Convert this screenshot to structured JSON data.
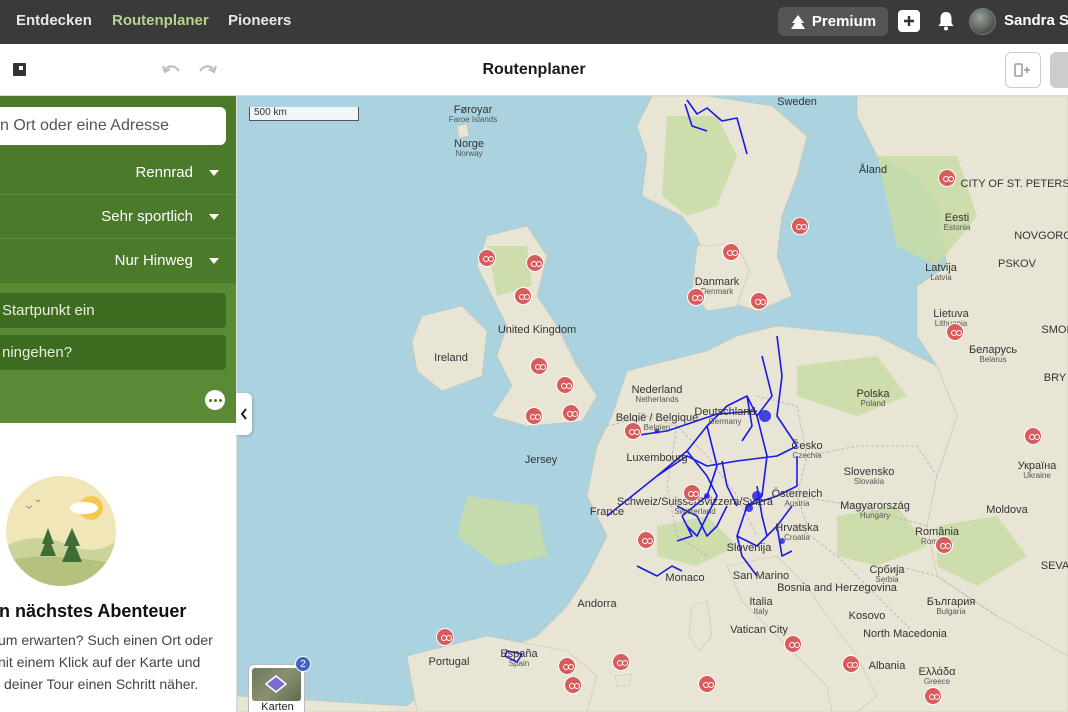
{
  "topnav": {
    "links": [
      "Entdecken",
      "Routenplaner",
      "Pioneers"
    ],
    "premium_label": "Premium",
    "username": "Sandra Sc"
  },
  "subbar": {
    "title": "Routenplaner"
  },
  "sidebar": {
    "search_placeholder": "n Ort oder eine Adresse",
    "sport": "Rennrad",
    "fitness": "Sehr sportlich",
    "route_type": "Nur Hinweg",
    "start_field": "Startpunkt ein",
    "dest_field": "ningehen?",
    "adventure_heading": "in nächstes Abenteuer",
    "adventure_lines": [
      "um erwarten? Such einen Ort oder",
      "nit einem Klick auf der Karte und",
      "deiner Tour einen Schritt näher."
    ]
  },
  "map": {
    "scale": "500 km",
    "layer_label": "Karten",
    "layer_badge": "2",
    "route_color": "#1a1ae6",
    "marker_color": "#d95b5b",
    "labels": [
      {
        "name": "Føroyar",
        "sub": "Faroe Islands"
      },
      {
        "name": "Norge",
        "sub": "Norway"
      },
      {
        "name": "Åland",
        "sub": ""
      },
      {
        "name": "CITY OF ST. PETERSBURG",
        "sub": ""
      },
      {
        "name": "Eesti",
        "sub": "Estonia"
      },
      {
        "name": "NOVGOROD",
        "sub": ""
      },
      {
        "name": "PSKOV",
        "sub": ""
      },
      {
        "name": "Latvija",
        "sub": "Latvia"
      },
      {
        "name": "Danmark",
        "sub": "Denmark"
      },
      {
        "name": "Lietuva",
        "sub": "Lithuania"
      },
      {
        "name": "SMOL",
        "sub": ""
      },
      {
        "name": "United Kingdom",
        "sub": ""
      },
      {
        "name": "Ireland",
        "sub": ""
      },
      {
        "name": "Беларусь",
        "sub": "Belarus"
      },
      {
        "name": "BRY",
        "sub": ""
      },
      {
        "name": "Nederland",
        "sub": "Netherlands"
      },
      {
        "name": "Polska",
        "sub": "Poland"
      },
      {
        "name": "België / Belgique",
        "sub": "Belgien"
      },
      {
        "name": "Deutschland",
        "sub": "Germany"
      },
      {
        "name": "Česko",
        "sub": "Czechia"
      },
      {
        "name": "Luxembourg",
        "sub": ""
      },
      {
        "name": "Jersey",
        "sub": ""
      },
      {
        "name": "Україна",
        "sub": "Ukraine"
      },
      {
        "name": "Slovensko",
        "sub": "Slovakia"
      },
      {
        "name": "Österreich",
        "sub": "Austria"
      },
      {
        "name": "Magyarország",
        "sub": "Hungary"
      },
      {
        "name": "Moldova",
        "sub": ""
      },
      {
        "name": "France",
        "sub": ""
      },
      {
        "name": "Schweiz/Suisse/Svizzera/Svizra",
        "sub": "Switzerland"
      },
      {
        "name": "Hrvatska",
        "sub": "Croatia"
      },
      {
        "name": "România",
        "sub": "Romania"
      },
      {
        "name": "Slovenija",
        "sub": ""
      },
      {
        "name": "Monaco",
        "sub": ""
      },
      {
        "name": "San Marino",
        "sub": ""
      },
      {
        "name": "Bosnia and Herzegovina",
        "sub": ""
      },
      {
        "name": "Србија",
        "sub": "Serbia"
      },
      {
        "name": "SEVA",
        "sub": ""
      },
      {
        "name": "Andorra",
        "sub": ""
      },
      {
        "name": "Italia",
        "sub": "Italy"
      },
      {
        "name": "Kosovo",
        "sub": ""
      },
      {
        "name": "България",
        "sub": "Bulgaria"
      },
      {
        "name": "Vatican City",
        "sub": ""
      },
      {
        "name": "North Macedonia",
        "sub": ""
      },
      {
        "name": "Portugal",
        "sub": ""
      },
      {
        "name": "España",
        "sub": "Spain"
      },
      {
        "name": "Albania",
        "sub": ""
      },
      {
        "name": "Ελλάδα",
        "sub": "Greece"
      },
      {
        "name": "Sweden",
        "sub": ""
      }
    ]
  }
}
